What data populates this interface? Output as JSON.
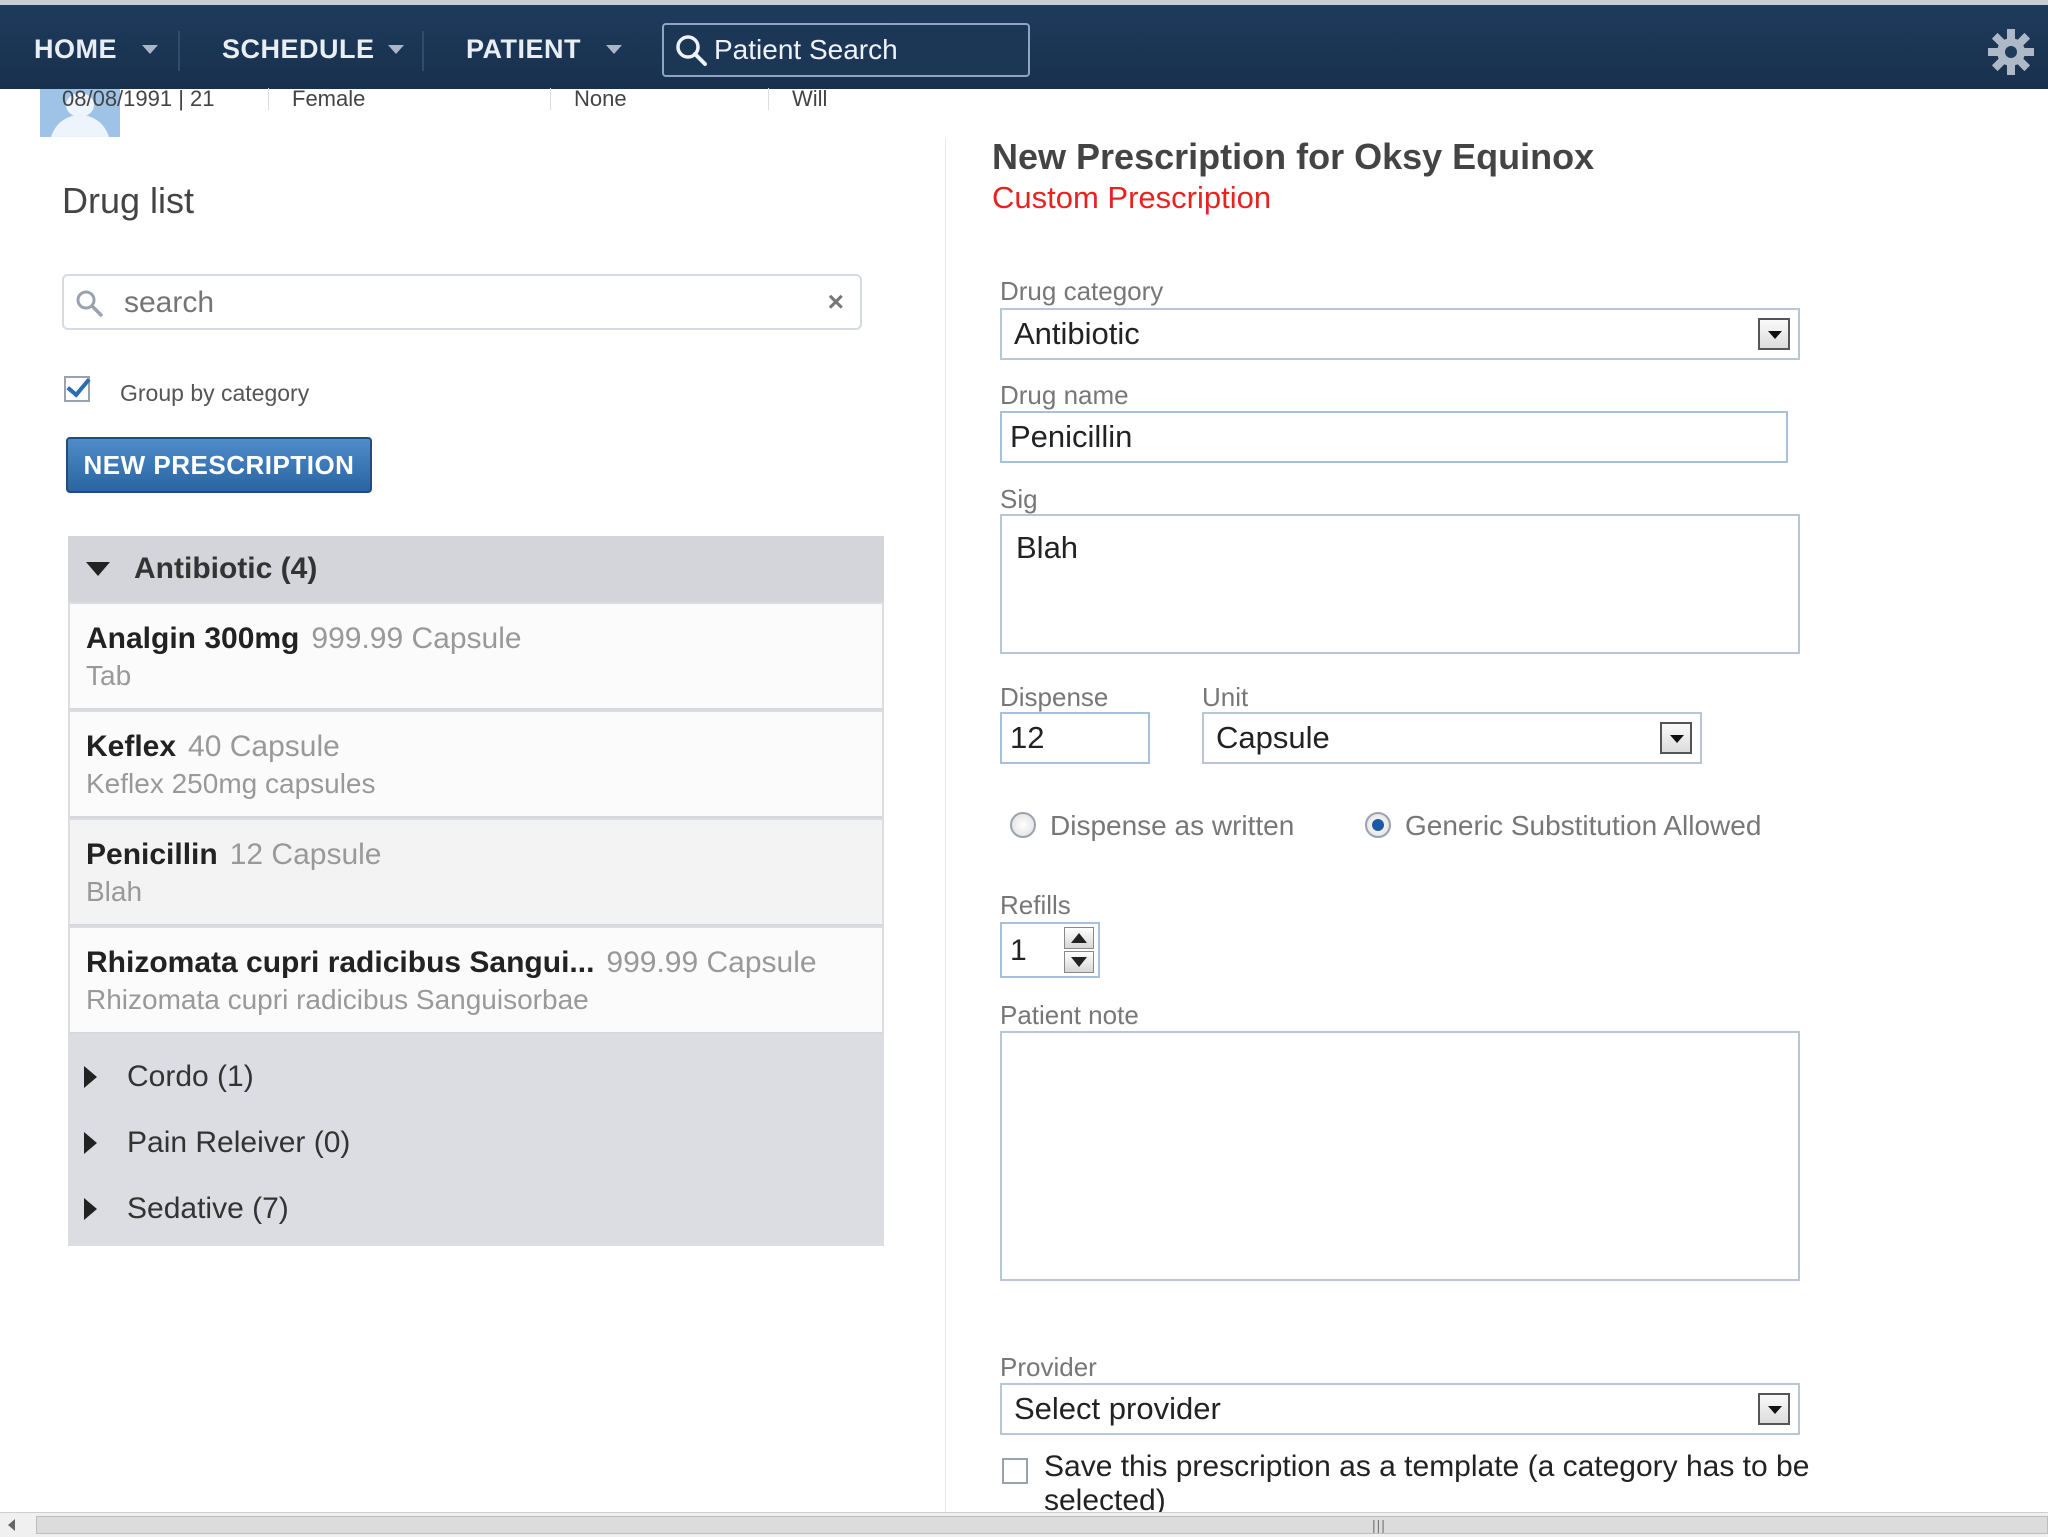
{
  "nav": {
    "home": "HOME",
    "schedule": "SCHEDULE",
    "patient": "PATIENT",
    "patient_search": "Patient Search"
  },
  "patient_strip": {
    "dob_age": "08/08/1991 | 21",
    "gender": "Female",
    "allergies": "None",
    "provider": "Will"
  },
  "drug_list": {
    "title": "Drug list",
    "search_placeholder": "search",
    "group_by_label": "Group by category",
    "group_by_checked": true,
    "new_prescription_button": "NEW PRESCRIPTION",
    "categories": [
      {
        "label": "Antibiotic (4)",
        "expanded": true
      },
      {
        "label": "Cordo (1)",
        "expanded": false
      },
      {
        "label": "Pain Releiver (0)",
        "expanded": false
      },
      {
        "label": "Sedative (7)",
        "expanded": false
      }
    ],
    "drugs": [
      {
        "name": "Analgin 300mg",
        "qty": "999.99 Capsule",
        "detail": "Tab"
      },
      {
        "name": "Keflex",
        "qty": "40 Capsule",
        "detail": "Keflex 250mg capsules"
      },
      {
        "name": "Penicillin",
        "qty": "12 Capsule",
        "detail": "Blah"
      },
      {
        "name": "Rhizomata cupri radicibus Sangui...",
        "qty": "999.99 Capsule",
        "detail": "Rhizomata cupri radicibus Sanguisorbae"
      }
    ]
  },
  "prescription": {
    "title": "New Prescription for Oksy Equinox",
    "subtitle": "Custom Prescription",
    "subtitle_color": "#e8231f",
    "drug_category_label": "Drug category",
    "drug_category_value": "Antibiotic",
    "drug_name_label": "Drug name",
    "drug_name_value": "Penicillin",
    "sig_label": "Sig",
    "sig_value": "Blah",
    "dispense_label": "Dispense",
    "dispense_value": "12",
    "unit_label": "Unit",
    "unit_value": "Capsule",
    "radio_dispense_as_written": "Dispense as written",
    "radio_generic_substitution": "Generic Substitution Allowed",
    "selected_radio": "generic_substitution",
    "refills_label": "Refills",
    "refills_value": "1",
    "patient_note_label": "Patient note",
    "patient_note_value": "",
    "provider_label": "Provider",
    "provider_value": "Select provider",
    "save_template_label": "Save this prescription as a template (a category has to be selected)",
    "save_template_checked": false
  },
  "colors": {
    "nav_bg": "#1f3b5c",
    "button_blue": "#3a78b8",
    "accent_red": "#e8231f"
  },
  "icons": [
    "search-icon",
    "gear-icon",
    "chevron-down-icon",
    "clear-icon",
    "avatar-icon"
  ]
}
